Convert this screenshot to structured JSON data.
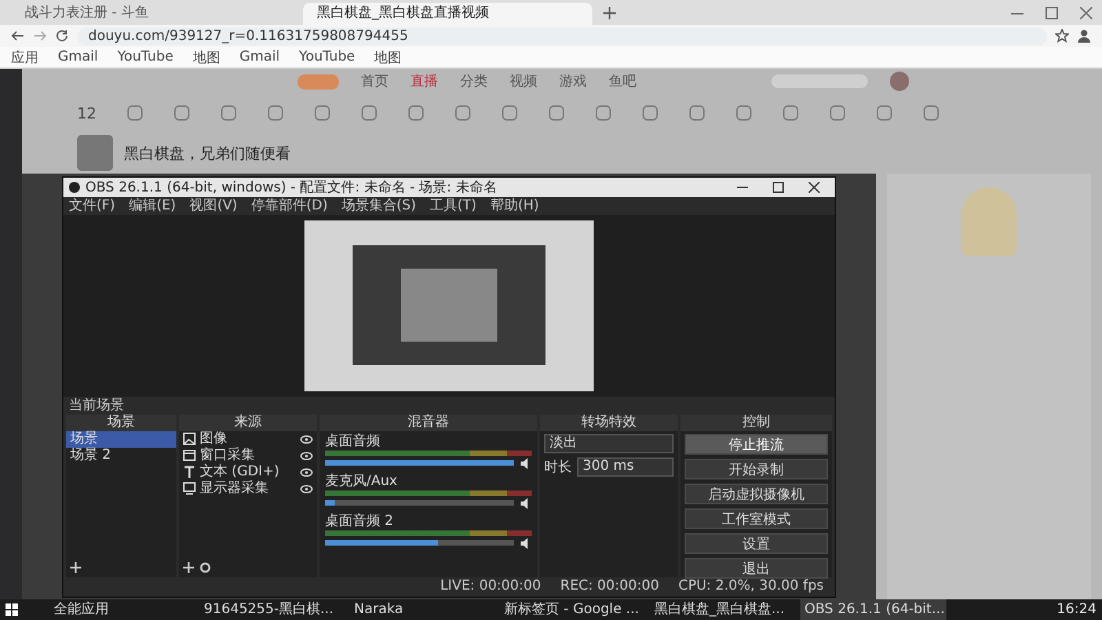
{
  "browser": {
    "tabs": [
      {
        "title": "战斗力表注册 - 斗鱼",
        "selected": false
      },
      {
        "title": "黑白棋盘_黑白棋盘直播视频",
        "selected": true
      }
    ],
    "url": "douyu.com/939127_r=0.11631759808794455",
    "bookmarks": [
      "应用",
      "Gmail",
      "YouTube",
      "地图",
      "Gmail",
      "YouTube",
      "地图"
    ]
  },
  "site": {
    "nav": [
      {
        "label": "首页",
        "selected": false
      },
      {
        "label": "直播",
        "selected": true
      },
      {
        "label": "分类",
        "selected": false
      },
      {
        "label": "视频",
        "selected": false
      },
      {
        "label": "游戏",
        "selected": false
      },
      {
        "label": "鱼吧",
        "selected": false
      }
    ],
    "level": "12",
    "room_title": "黑白棋盘，兄弟们随便看"
  },
  "obs": {
    "title": "OBS 26.1.1 (64-bit, windows) - 配置文件: 未命名 - 场景: 未命名",
    "menu": [
      "文件(F)",
      "编辑(E)",
      "视图(V)",
      "停靠部件(D)",
      "场景集合(S)",
      "工具(T)",
      "帮助(H)"
    ],
    "scene_label": "当前场景",
    "panels": [
      "场景",
      "来源",
      "混音器",
      "转场特效",
      "控制"
    ],
    "scenes": [
      {
        "name": "场景",
        "selected": true
      },
      {
        "name": "场景 2",
        "selected": false
      }
    ],
    "sources": [
      {
        "name": "图像",
        "kind": "image"
      },
      {
        "name": "窗口采集",
        "kind": "window"
      },
      {
        "name": "文本 (GDI+)",
        "kind": "text"
      },
      {
        "name": "显示器采集",
        "kind": "display"
      }
    ],
    "mixer": [
      {
        "name": "桌面音频",
        "level": 1.0
      },
      {
        "name": "麦克风/Aux",
        "level": 0.05
      },
      {
        "name": "桌面音频 2",
        "level": 0.6
      }
    ],
    "transition": {
      "value": "淡出",
      "duration_label": "时长",
      "duration": "300 ms"
    },
    "controls": [
      {
        "label": "停止推流",
        "selected": true
      },
      {
        "label": "开始录制",
        "selected": false
      },
      {
        "label": "启动虚拟摄像机",
        "selected": false
      },
      {
        "label": "工作室模式",
        "selected": false
      },
      {
        "label": "设置",
        "selected": false
      },
      {
        "label": "退出",
        "selected": false
      }
    ],
    "status": [
      "LIVE: 00:00:00",
      "REC: 00:00:00",
      "CPU: 2.0%, 30.00 fps"
    ]
  },
  "taskbar": {
    "items": [
      {
        "label": "全能应用",
        "selected": false
      },
      {
        "label": "91645255-黑白棋...",
        "selected": false
      },
      {
        "label": "Naraka",
        "selected": false
      },
      {
        "label": "新标签页 - Google ...",
        "selected": false
      },
      {
        "label": "黑白棋盘_黑白棋盘...",
        "selected": false
      },
      {
        "label": "OBS 26.1.1 (64-bit...",
        "selected": true
      }
    ],
    "clock": "16:24"
  }
}
